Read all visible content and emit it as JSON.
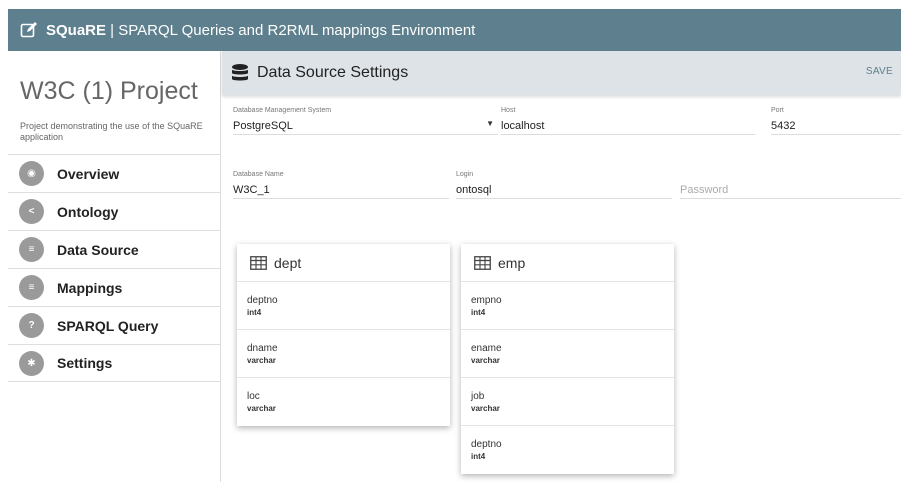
{
  "app": {
    "brand": "SQuaRE",
    "title_rest": " | SPARQL Queries and R2RML mappings Environment"
  },
  "project": {
    "title": "W3C (1) Project",
    "description": "Project demonstrating the use of the SQuaRE application"
  },
  "sidebar": {
    "items": [
      {
        "label": "Overview",
        "icon": "eye-icon",
        "glyph": "◉"
      },
      {
        "label": "Ontology",
        "icon": "share-icon",
        "glyph": "<"
      },
      {
        "label": "Data Source",
        "icon": "database-icon",
        "glyph": "≡"
      },
      {
        "label": "Mappings",
        "icon": "list-icon",
        "glyph": "≡"
      },
      {
        "label": "SPARQL Query",
        "icon": "question-icon",
        "glyph": "?"
      },
      {
        "label": "Settings",
        "icon": "gear-icon",
        "glyph": "✱"
      }
    ]
  },
  "header": {
    "title": "Data Source Settings",
    "save_label": "SAVE"
  },
  "form": {
    "dbms": {
      "label": "Database Management System",
      "value": "PostgreSQL"
    },
    "host": {
      "label": "Host",
      "value": "localhost"
    },
    "port": {
      "label": "Port",
      "value": "5432"
    },
    "db_name": {
      "label": "Database Name",
      "value": "W3C_1"
    },
    "login": {
      "label": "Login",
      "value": "ontosql"
    },
    "password": {
      "placeholder": "Password"
    }
  },
  "tables": [
    {
      "name": "dept",
      "columns": [
        {
          "name": "deptno",
          "type": "int4"
        },
        {
          "name": "dname",
          "type": "varchar"
        },
        {
          "name": "loc",
          "type": "varchar"
        }
      ]
    },
    {
      "name": "emp",
      "columns": [
        {
          "name": "empno",
          "type": "int4"
        },
        {
          "name": "ename",
          "type": "varchar"
        },
        {
          "name": "job",
          "type": "varchar"
        },
        {
          "name": "deptno",
          "type": "int4"
        }
      ]
    }
  ],
  "colors": {
    "topbar": "#5d7f8e",
    "header": "#dde3e7",
    "nav_icon": "#9a9a9a"
  }
}
